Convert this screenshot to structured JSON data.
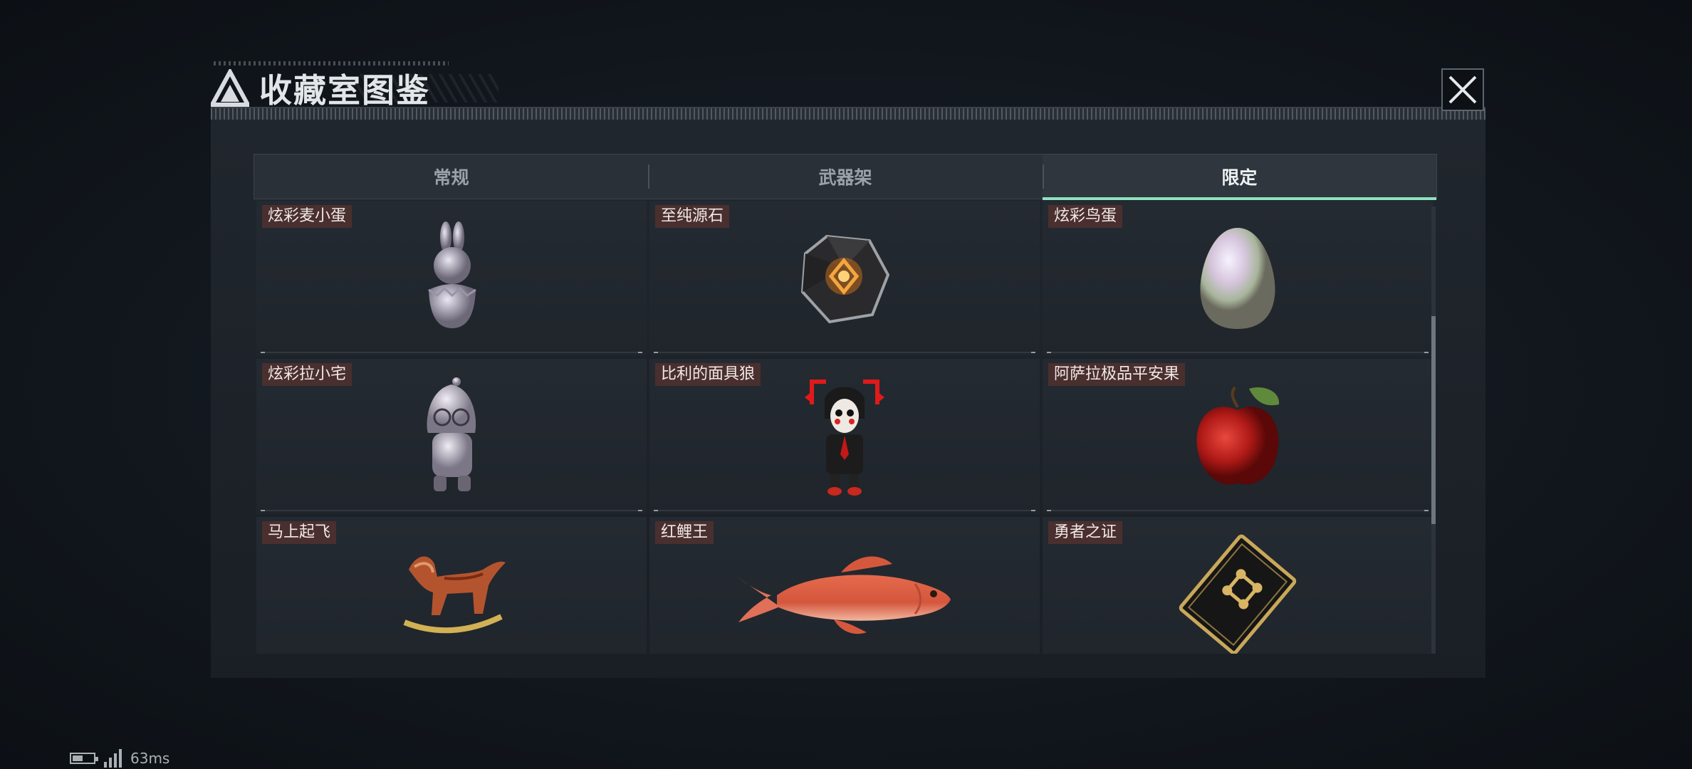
{
  "modal": {
    "title": "收藏室图鉴",
    "close_icon": "close-icon"
  },
  "tabs": [
    {
      "label": "常规",
      "active": false
    },
    {
      "label": "武器架",
      "active": false
    },
    {
      "label": "限定",
      "active": true
    }
  ],
  "items": [
    {
      "label": "炫彩麦小蛋",
      "icon": "bunny-egg-figurine-icon"
    },
    {
      "label": "至纯源石",
      "icon": "crystal-stone-icon"
    },
    {
      "label": "炫彩鸟蛋",
      "icon": "pearl-egg-icon"
    },
    {
      "label": "炫彩拉小宅",
      "icon": "hooded-figurine-icon"
    },
    {
      "label": "比利的面具狼",
      "icon": "puppet-mask-figure-icon"
    },
    {
      "label": "阿萨拉极品平安果",
      "icon": "apple-icon"
    },
    {
      "label": "马上起飞",
      "icon": "rocking-horse-icon"
    },
    {
      "label": "红鲤王",
      "icon": "carp-fish-icon"
    },
    {
      "label": "勇者之证",
      "icon": "gold-card-icon"
    }
  ],
  "status_bar": {
    "ping": "63ms"
  },
  "colors": {
    "accent": "#8fe1c0",
    "label_bg": "#4a2f2f"
  }
}
